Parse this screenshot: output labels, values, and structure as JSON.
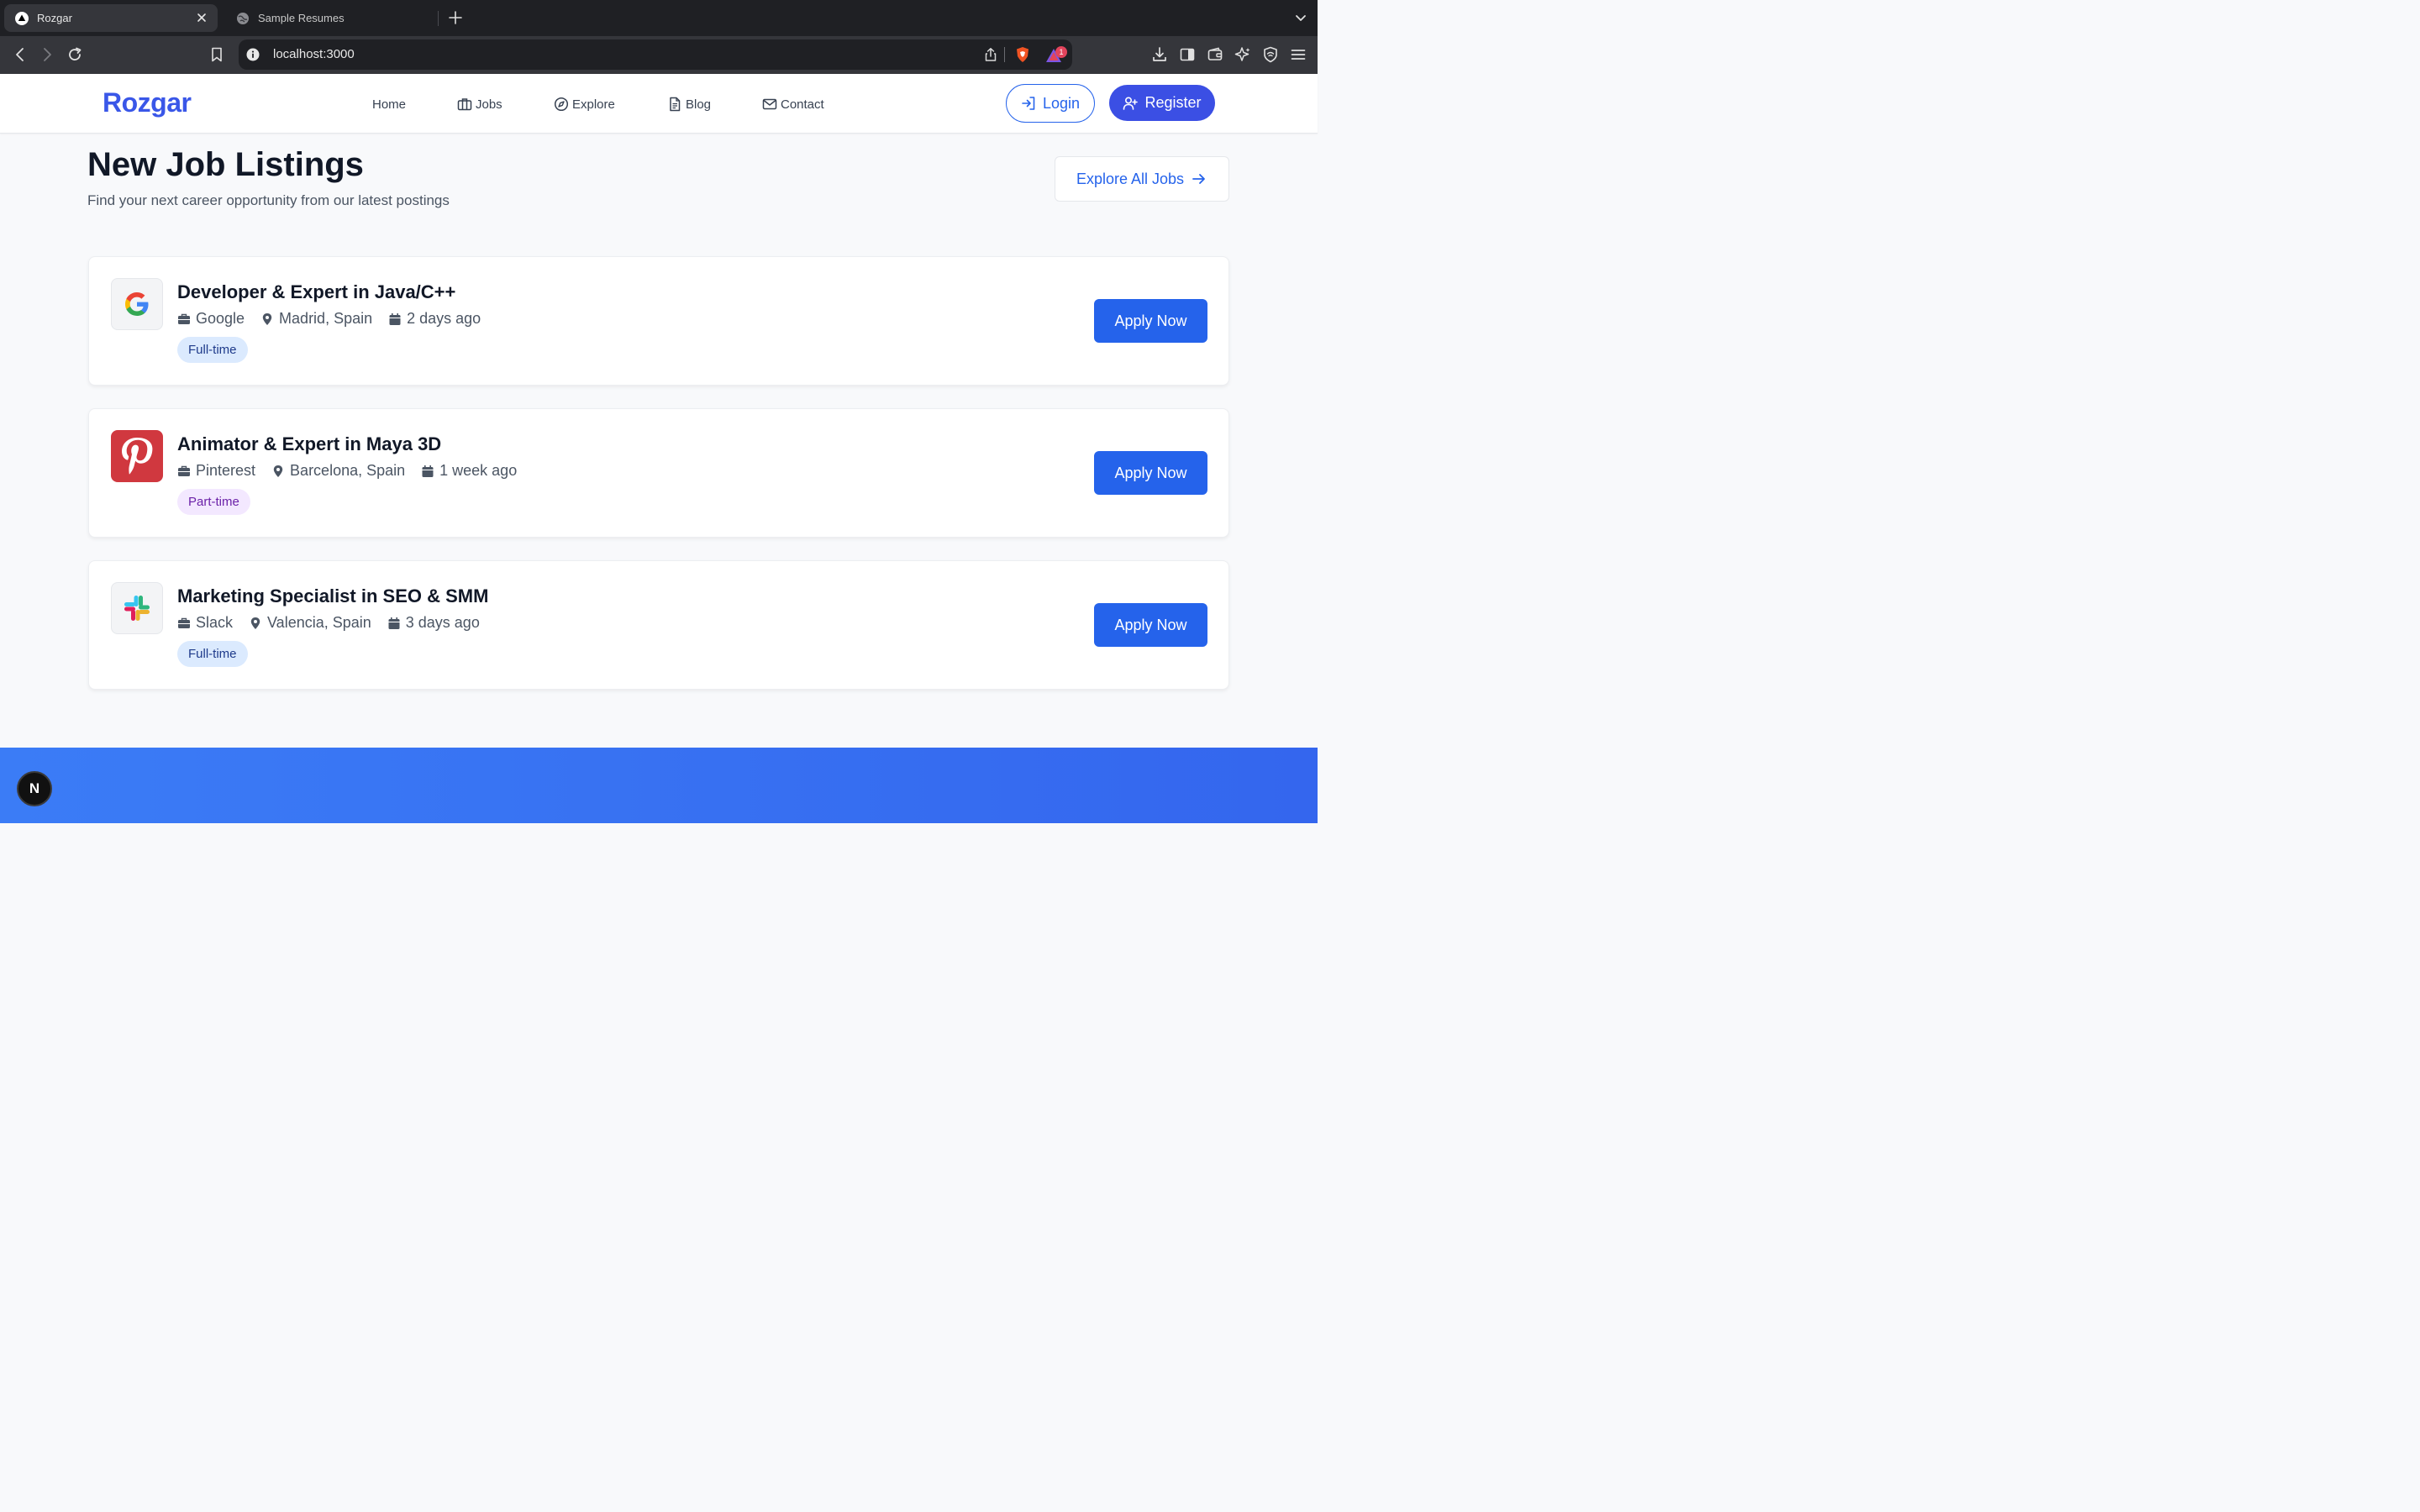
{
  "browser": {
    "tabs": [
      {
        "title": "Rozgar",
        "active": true
      },
      {
        "title": "Sample Resumes",
        "active": false
      }
    ],
    "url": "localhost:3000",
    "notification_count": "1"
  },
  "header": {
    "logo": "Rozgar",
    "nav": [
      {
        "label": "Home",
        "icon": "none"
      },
      {
        "label": "Jobs",
        "icon": "briefcase-icon"
      },
      {
        "label": "Explore",
        "icon": "compass-icon"
      },
      {
        "label": "Blog",
        "icon": "document-icon"
      },
      {
        "label": "Contact",
        "icon": "mail-icon"
      }
    ],
    "login_label": "Login",
    "register_label": "Register"
  },
  "section": {
    "title": "New Job Listings",
    "subtitle": "Find your next career opportunity from our latest postings",
    "explore_label": "Explore All Jobs"
  },
  "jobs": [
    {
      "title": "Developer & Expert in Java/C++",
      "company": "Google",
      "location": "Madrid, Spain",
      "posted": "2 days ago",
      "type": "Full-time",
      "apply": "Apply Now"
    },
    {
      "title": "Animator & Expert in Maya 3D",
      "company": "Pinterest",
      "location": "Barcelona, Spain",
      "posted": "1 week ago",
      "type": "Part-time",
      "apply": "Apply Now"
    },
    {
      "title": "Marketing Specialist in SEO & SMM",
      "company": "Slack",
      "location": "Valencia, Spain",
      "posted": "3 days ago",
      "type": "Full-time",
      "apply": "Apply Now"
    }
  ],
  "dev_badge": "N",
  "colors": {
    "brand": "#3a57e8",
    "primary": "#2563eb",
    "fulltime_bg": "#dbeafe",
    "parttime_bg": "#f3e8ff",
    "footer": "#3b7cf6"
  }
}
